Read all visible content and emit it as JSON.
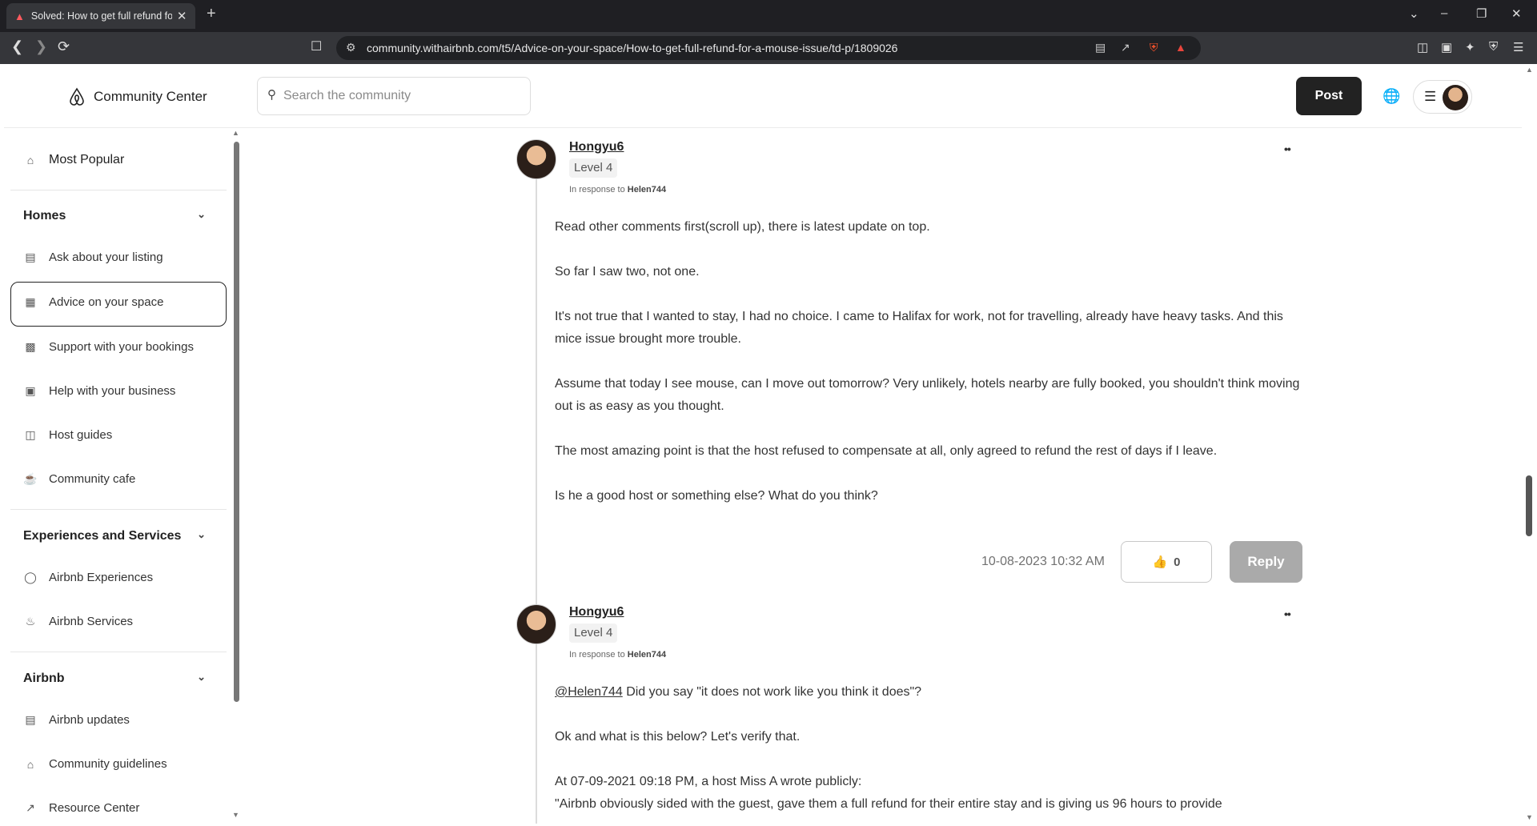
{
  "browser": {
    "tab_title": "Solved: How to get full refund for a mouse issue",
    "url": "community.withairbnb.com/t5/Advice-on-your-space/How-to-get-full-refund-for-a-mouse-issue/td-p/1809026"
  },
  "header": {
    "brand": "Community Center",
    "search_placeholder": "Search the community",
    "post_label": "Post"
  },
  "sidebar": {
    "most_popular": "Most Popular",
    "homes": {
      "title": "Homes",
      "items": [
        "Ask about your listing",
        "Advice on your space",
        "Support with your bookings",
        "Help with your business",
        "Host guides",
        "Community cafe"
      ]
    },
    "experiences": {
      "title": "Experiences and Services",
      "items": [
        "Airbnb Experiences",
        "Airbnb Services"
      ]
    },
    "airbnb": {
      "title": "Airbnb",
      "items": [
        "Airbnb updates",
        "Community guidelines",
        "Resource Center"
      ]
    }
  },
  "posts": [
    {
      "author": "Hongyu6",
      "level": "Level 4",
      "in_response_prefix": "In response to",
      "in_response_to": "Helen744",
      "paragraphs": [
        "Read other comments first(scroll up), there is latest update on top.",
        "So far I saw two, not one.",
        "It's not true that I wanted to stay, I had no choice. I came to Halifax for work, not for travelling, already have heavy tasks. And this mice issue brought more trouble.",
        "Assume that today I see mouse, can I move out tomorrow? Very unlikely, hotels nearby are fully booked, you shouldn't think moving out is as easy as you thought.",
        "The most amazing point is that the host refused to compensate at all, only agreed to refund the rest of days if I leave.",
        "Is he a good host or something else? What do you think?"
      ],
      "timestamp": "10-08-2023 10:32 AM",
      "likes": "0",
      "reply_label": "Reply"
    },
    {
      "author": "Hongyu6",
      "level": "Level 4",
      "in_response_prefix": "In response to",
      "in_response_to": "Helen744",
      "mention": "@Helen744",
      "first_line_rest": " Did you say \"it does not work like you think it does\"?",
      "paragraphs": [
        "Ok and what is this below? Let's verify that.",
        "At 07-09-2021 09:18 PM, a host Miss A wrote publicly:",
        "\"Airbnb obviously sided with the guest, gave them a full refund for their entire stay and is giving us 96 hours to provide"
      ]
    }
  ],
  "colors": {
    "brand_dark": "#222222",
    "reply_disabled": "#aaaaaa",
    "browser_chrome": "#35363a"
  }
}
